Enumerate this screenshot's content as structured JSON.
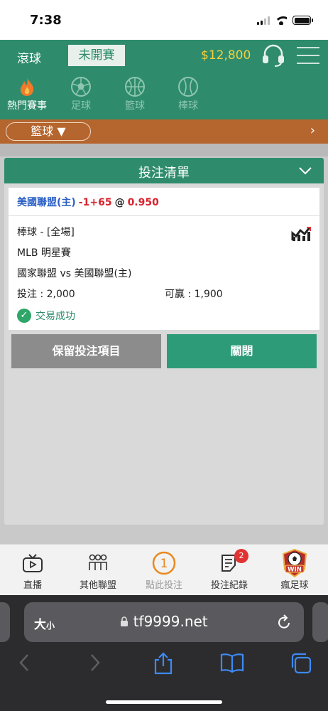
{
  "status_bar": {
    "time": "7:38"
  },
  "header": {
    "live_tab": "滾球",
    "upcoming_tab": "未開賽",
    "balance": "$12,800",
    "accent_color": "#2e8c6c",
    "balance_color": "#f3d040"
  },
  "sports": [
    {
      "label": "熱門賽事",
      "icon": "fire-icon",
      "active": true
    },
    {
      "label": "足球",
      "icon": "soccer-ball-icon",
      "active": false
    },
    {
      "label": "籃球",
      "icon": "basketball-icon",
      "active": false
    },
    {
      "label": "棒球",
      "icon": "baseball-icon",
      "active": false
    }
  ],
  "filter": {
    "selected": "籃球 ▼",
    "next": "›"
  },
  "bet_slip": {
    "title": "投注清單",
    "selection": {
      "team": "美國聯盟(主)",
      "handicap": "-1+65",
      "at": "@",
      "odds": "0.950"
    },
    "sport_market": "棒球 - [全場]",
    "league": "MLB 明星賽",
    "match": "國家聯盟 vs 美國聯盟(主)",
    "stake": "投注 : 2,000",
    "to_win": "可贏 : 1,900",
    "result": "交易成功",
    "keep_button": "保留投注項目",
    "close_button": "關閉"
  },
  "bottom_nav": [
    {
      "label": "直播",
      "icon": "tv-icon"
    },
    {
      "label": "其他聯盟",
      "icon": "people-icon"
    },
    {
      "label": "點此投注",
      "icon": "bet-count-icon",
      "count": "1"
    },
    {
      "label": "投注紀錄",
      "icon": "record-icon",
      "badge": "2"
    },
    {
      "label": "瘋足球",
      "icon": "win-logo-icon",
      "logo_text": "WIN"
    }
  ],
  "browser": {
    "text_size": "大",
    "text_size_small": "小",
    "url": "tf9999.net"
  }
}
